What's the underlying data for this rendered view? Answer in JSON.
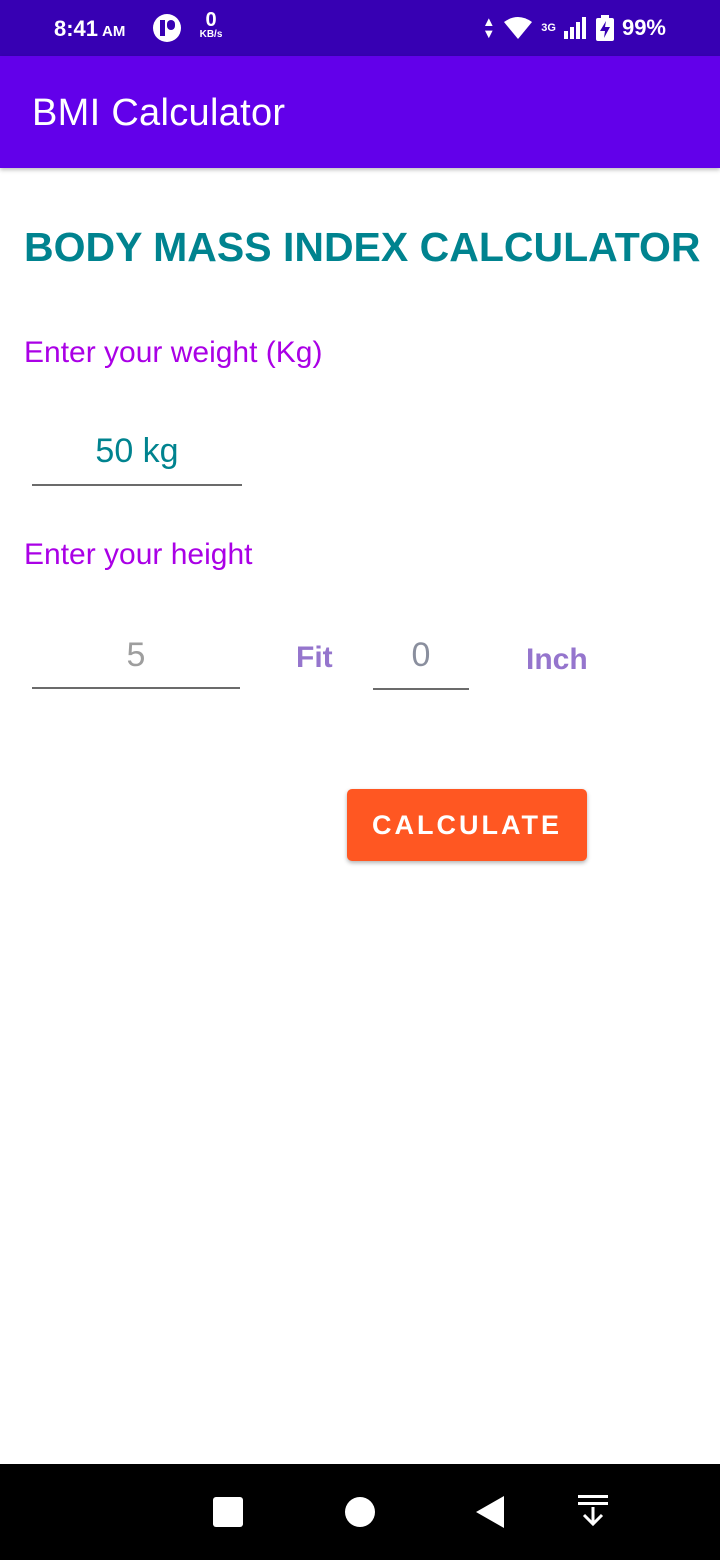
{
  "status_bar": {
    "time": "8:41",
    "ampm": "AM",
    "speed_value": "0",
    "speed_unit": "KB/s",
    "network_type": "3G",
    "battery": "99%"
  },
  "app_bar": {
    "title": "BMI Calculator"
  },
  "main": {
    "heading": "BODY MASS INDEX CALCULATOR",
    "weight_label": "Enter your weight (Kg)",
    "weight_value": "50 kg",
    "height_label": "Enter your height",
    "feet_placeholder": "5",
    "feet_unit": "Fit",
    "inch_placeholder": "0",
    "inch_unit": "Inch",
    "calculate_button": "CALCULATE"
  },
  "colors": {
    "status_bar": "#3700b3",
    "app_bar": "#6200ea",
    "heading": "#00838f",
    "label": "#aa00e6",
    "unit_label": "#9575cd",
    "button": "#ff5722"
  },
  "nav_bar": {
    "icons": [
      "square-recent-icon",
      "circle-home-icon",
      "triangle-back-icon",
      "notification-pull-icon"
    ]
  }
}
